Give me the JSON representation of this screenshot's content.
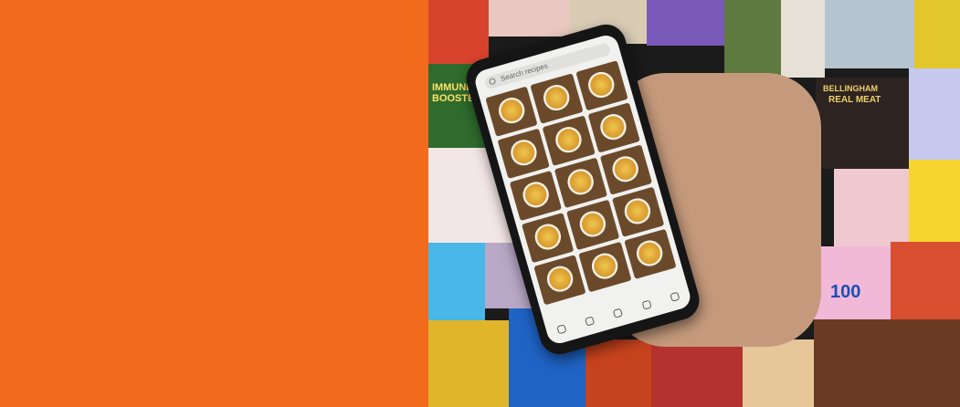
{
  "banner": {
    "panel_color": "#f26b1d",
    "collage_texts": {
      "immune_boosters": "IMMUNE BOOSTERS",
      "bellingham": "BELLINGHAM",
      "real_meat": "REAL MEAT",
      "tile_number": "100"
    },
    "phone_app": {
      "search_placeholder": "Search recipes"
    }
  }
}
